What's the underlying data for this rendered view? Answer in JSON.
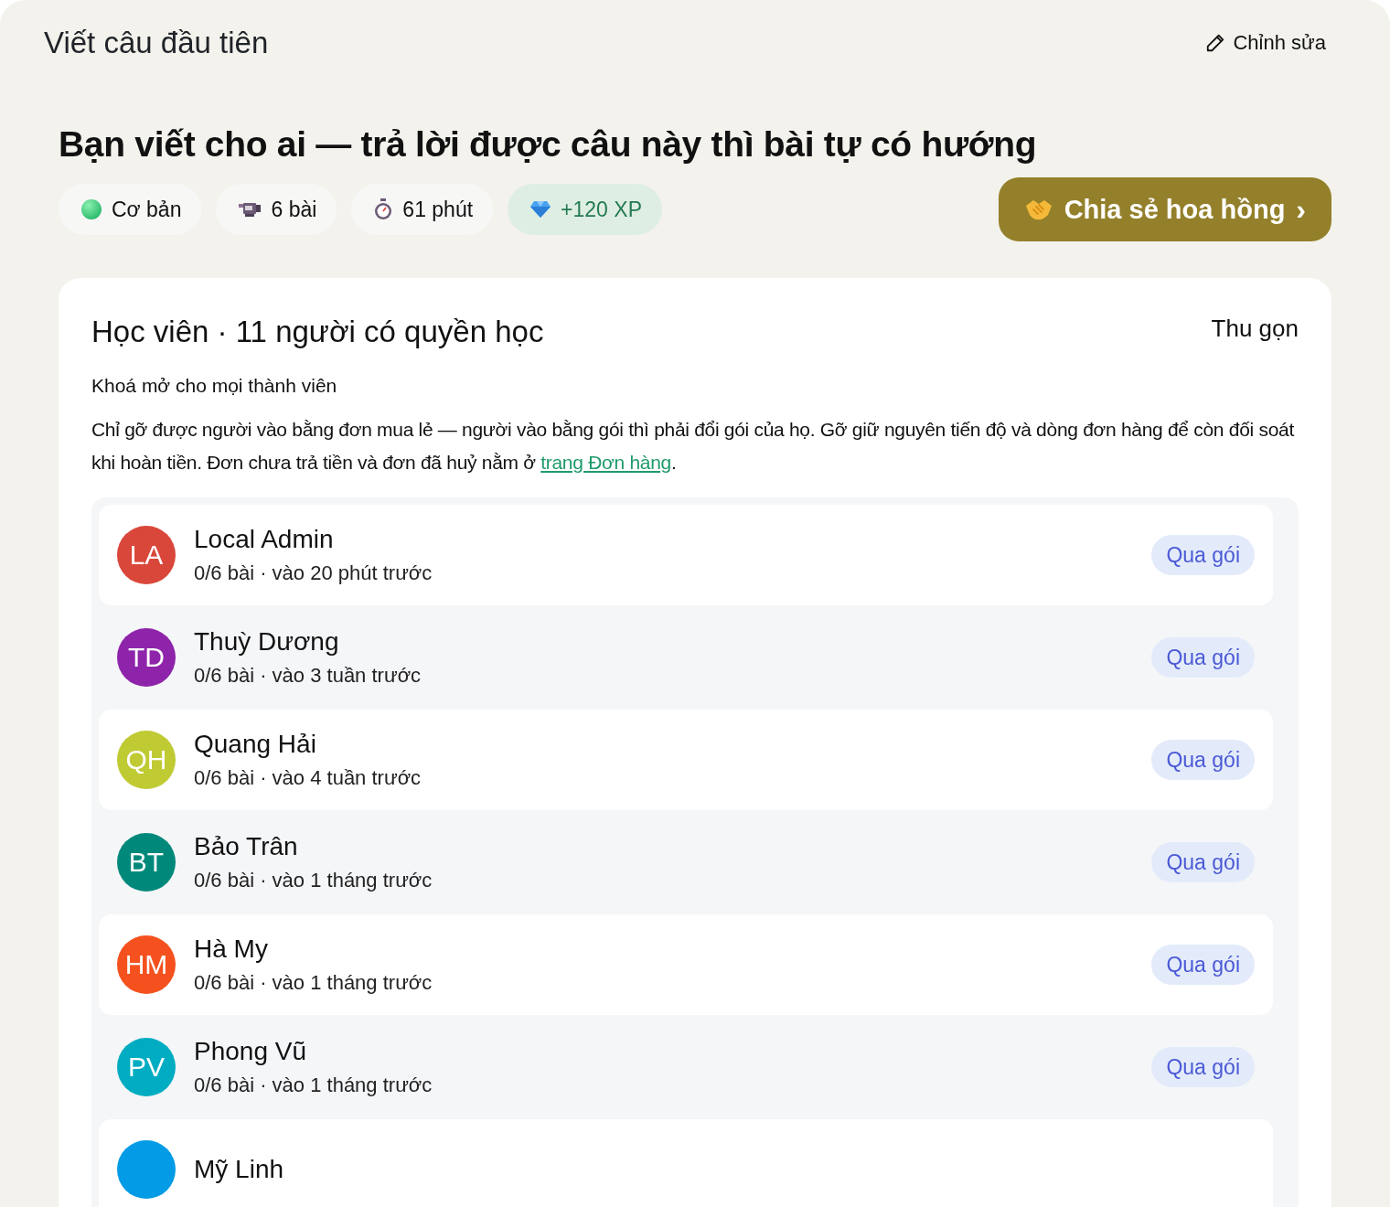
{
  "page_title": "Viết câu đầu tiên",
  "edit_button": "Chỉnh sửa",
  "heading": "Bạn viết cho ai — trả lời được câu này thì bài tự có hướng",
  "chips": [
    {
      "kind": "level",
      "label": "Cơ bản"
    },
    {
      "kind": "lessons",
      "label": "6 bài"
    },
    {
      "kind": "time",
      "label": "61 phút"
    },
    {
      "kind": "xp",
      "label": "+120 XP"
    }
  ],
  "share_button": {
    "label": "Chia sẻ hoa hồng",
    "arrow": "›"
  },
  "students": {
    "title": "Học viên · 11 người có quyền học",
    "collapse": "Thu gọn",
    "subtitle": "Khoá mở cho mọi thành viên",
    "note": "Chỉ gỡ được người vào bằng đơn mua lẻ — người vào bằng gói thì phải đổi gói của họ. Gỡ giữ nguyên tiến độ và dòng đơn hàng để còn đối soát khi hoàn tiền. Đơn chưa trả tiền và đơn đã huỷ nằm ở ",
    "note_link": "trang Đơn hàng",
    "note_end": ".",
    "rows": [
      {
        "initials": "LA",
        "color": "#d9473a",
        "name": "Local Admin",
        "meta": "0/6 bài · vào 20 phút trước",
        "action": "Qua gói"
      },
      {
        "initials": "TD",
        "color": "#8e24aa",
        "name": "Thuỳ Dương",
        "meta": "0/6 bài · vào 3 tuần trước",
        "action": "Qua gói"
      },
      {
        "initials": "QH",
        "color": "#c0ca33",
        "name": "Quang Hải",
        "meta": "0/6 bài · vào 4 tuần trước",
        "action": "Qua gói"
      },
      {
        "initials": "BT",
        "color": "#00897b",
        "name": "Bảo Trân",
        "meta": "0/6 bài · vào 1 tháng trước",
        "action": "Qua gói"
      },
      {
        "initials": "HM",
        "color": "#f4511e",
        "name": "Hà My",
        "meta": "0/6 bài · vào 1 tháng trước",
        "action": "Qua gói"
      },
      {
        "initials": "PV",
        "color": "#00acc1",
        "name": "Phong Vũ",
        "meta": "0/6 bài · vào 1 tháng trước",
        "action": "Qua gói"
      },
      {
        "color": "#039be5",
        "name": "Mỹ Linh"
      }
    ]
  }
}
